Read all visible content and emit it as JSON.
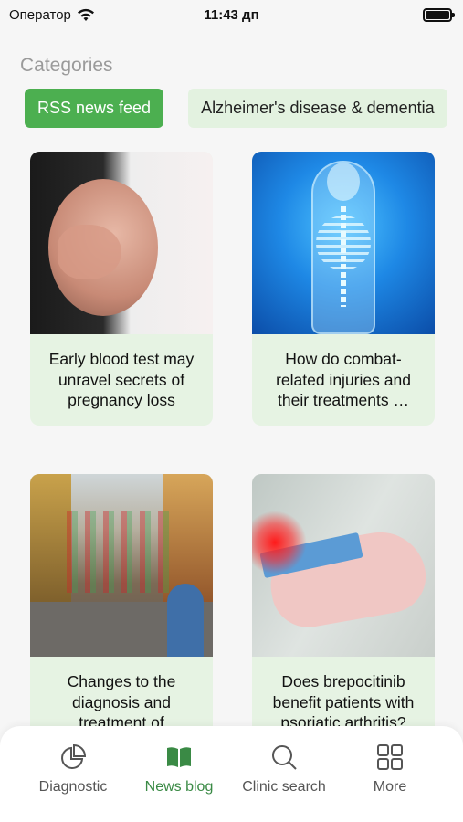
{
  "status_bar": {
    "carrier": "Оператор",
    "time": "11:43 дп"
  },
  "categories": {
    "title": "Categories",
    "chips": [
      {
        "label": "RSS news feed",
        "active": true
      },
      {
        "label": "Alzheimer's disease & dementia",
        "active": false
      }
    ]
  },
  "cards": [
    {
      "title": "Early blood test may unravel secrets of pregnancy loss",
      "image": "pregnant-belly"
    },
    {
      "title": "How do combat-related injuries and their treatments …",
      "image": "skeleton-xray"
    },
    {
      "title": "Changes to the diagnosis and treatment of",
      "image": "city-street"
    },
    {
      "title": "Does brepocitinib benefit patients with psoriatic arthritis?",
      "image": "hand-pain"
    }
  ],
  "tabs": [
    {
      "label": "Diagnostic",
      "icon": "pie-chart-icon"
    },
    {
      "label": "News blog",
      "icon": "book-icon",
      "active": true
    },
    {
      "label": "Clinic search",
      "icon": "search-icon"
    },
    {
      "label": "More",
      "icon": "grid-icon"
    }
  ],
  "colors": {
    "accent": "#4caf50",
    "chip_bg": "#e3f2e0",
    "card_bg": "#e6f3e3",
    "active_tab": "#3a8a45"
  }
}
